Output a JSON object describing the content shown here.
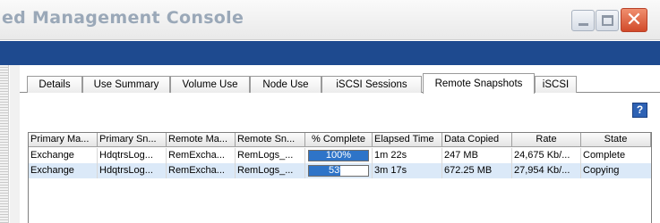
{
  "window": {
    "title": "ed Management Console",
    "minimize_icon": "minimize-icon",
    "maximize_icon": "maximize-icon",
    "close_icon": "close-icon"
  },
  "tabs": [
    {
      "label": "Details"
    },
    {
      "label": "Use Summary"
    },
    {
      "label": "Volume Use"
    },
    {
      "label": "Node Use"
    },
    {
      "label": "iSCSI Sessions"
    },
    {
      "label": "Remote Snapshots",
      "active": true
    },
    {
      "label": "iSCSI"
    }
  ],
  "help": {
    "label": "?"
  },
  "table": {
    "columns": [
      "Primary Ma...",
      "Primary Sn...",
      "Remote Ma...",
      "Remote Sn...",
      "% Complete",
      "Elapsed Time",
      "Data Copied",
      "Rate",
      "State"
    ],
    "rows": [
      {
        "primary_management_group": "Exchange",
        "primary_snapshot": "HdqtrsLog...",
        "remote_management_group": "RemExcha...",
        "remote_snapshot": "RemLogs_...",
        "percent_complete_label": "100%",
        "percent_complete": 100,
        "elapsed_time": "1m 22s",
        "data_copied": "247 MB",
        "rate": "24,675 Kb/...",
        "state": "Complete"
      },
      {
        "primary_management_group": "Exchange",
        "primary_snapshot": "HdqtrsLog...",
        "remote_management_group": "RemExcha...",
        "remote_snapshot": "RemLogs_...",
        "percent_complete_label": "53%",
        "percent_complete": 53,
        "elapsed_time": "3m 17s",
        "data_copied": "672.25 MB",
        "rate": "27,954 Kb/...",
        "state": "Copying"
      }
    ]
  },
  "colors": {
    "header_bar": "#1e4a8f",
    "progress_fill": "#2e74c8",
    "selected_row": "#dbe9f8"
  }
}
